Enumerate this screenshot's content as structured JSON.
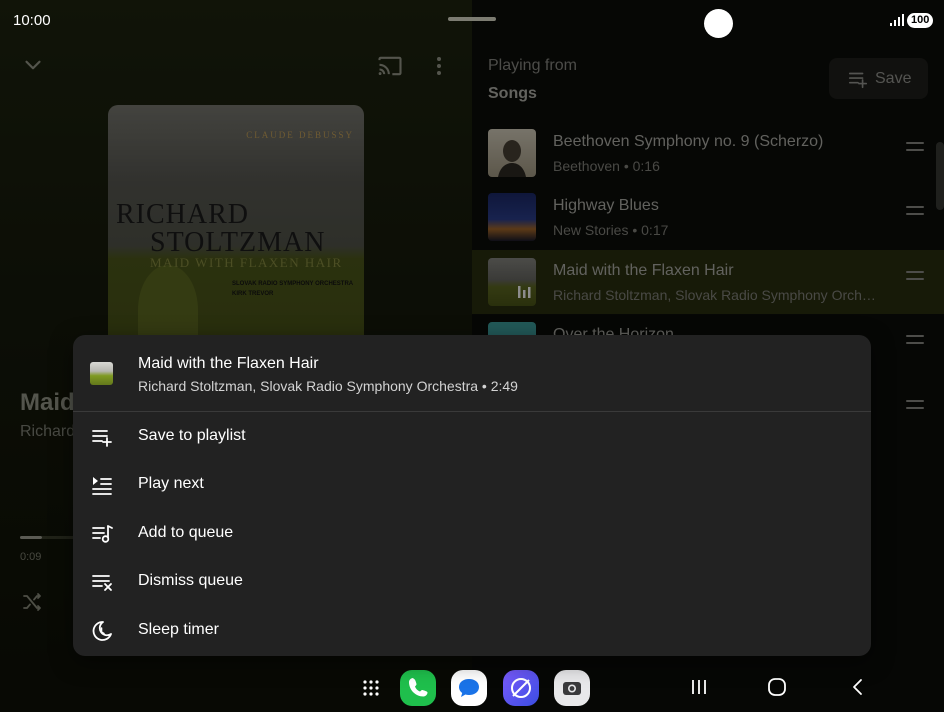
{
  "status_bar": {
    "time": "10:00",
    "battery": "100"
  },
  "album_art": {
    "composer": "CLAUDE DEBUSSY",
    "name_line1": "RICHARD",
    "name_line2": "STOLTZMAN",
    "title": "MAID WITH FLAXEN HAIR",
    "orchestra_line1": "SLOVAK RADIO SYMPHONY ORCHESTRA",
    "orchestra_line2": "KIRK TREVOR"
  },
  "now_playing": {
    "title": "Maid with the Flaxen Hair",
    "artist": "Richard Stoltzman, Slovak Radio Symphony Orchestra",
    "elapsed": "0:09",
    "progress_fraction": 0.07
  },
  "queue": {
    "playing_from": "Playing from",
    "source": "Songs",
    "save_label": "Save",
    "items": [
      {
        "title": "Beethoven Symphony no. 9 (Scherzo)",
        "subtitle": "Beethoven • 0:16",
        "active": false
      },
      {
        "title": "Highway Blues",
        "subtitle": "New Stories • 0:17",
        "active": false
      },
      {
        "title": "Maid with the Flaxen Hair",
        "subtitle": "Richard Stoltzman, Slovak Radio Symphony Orchestra • 2:49",
        "active": true
      },
      {
        "title": "Over the Horizon",
        "subtitle": "",
        "active": false
      }
    ]
  },
  "context_menu": {
    "song_title": "Maid with the Flaxen Hair",
    "song_subtitle": "Richard Stoltzman, Slovak Radio Symphony Orchestra • 2:49",
    "items": [
      {
        "label": "Save to playlist",
        "icon": "playlist-add-icon"
      },
      {
        "label": "Play next",
        "icon": "play-next-icon"
      },
      {
        "label": "Add to queue",
        "icon": "add-to-queue-icon"
      },
      {
        "label": "Dismiss queue",
        "icon": "dismiss-queue-icon"
      },
      {
        "label": "Sleep timer",
        "icon": "sleep-timer-icon"
      }
    ]
  },
  "dock": {
    "apps": [
      "apps-grid-icon",
      "phone-app-icon",
      "messages-app-icon",
      "internet-app-icon",
      "camera-app-icon"
    ],
    "nav": [
      "recents-icon",
      "home-icon",
      "back-icon"
    ]
  },
  "colors": {
    "accent_active_row": "#2b300f",
    "menu_bg": "#222222",
    "phone_green": "#1fbf4c",
    "messages_blue": "#1a73e8"
  }
}
